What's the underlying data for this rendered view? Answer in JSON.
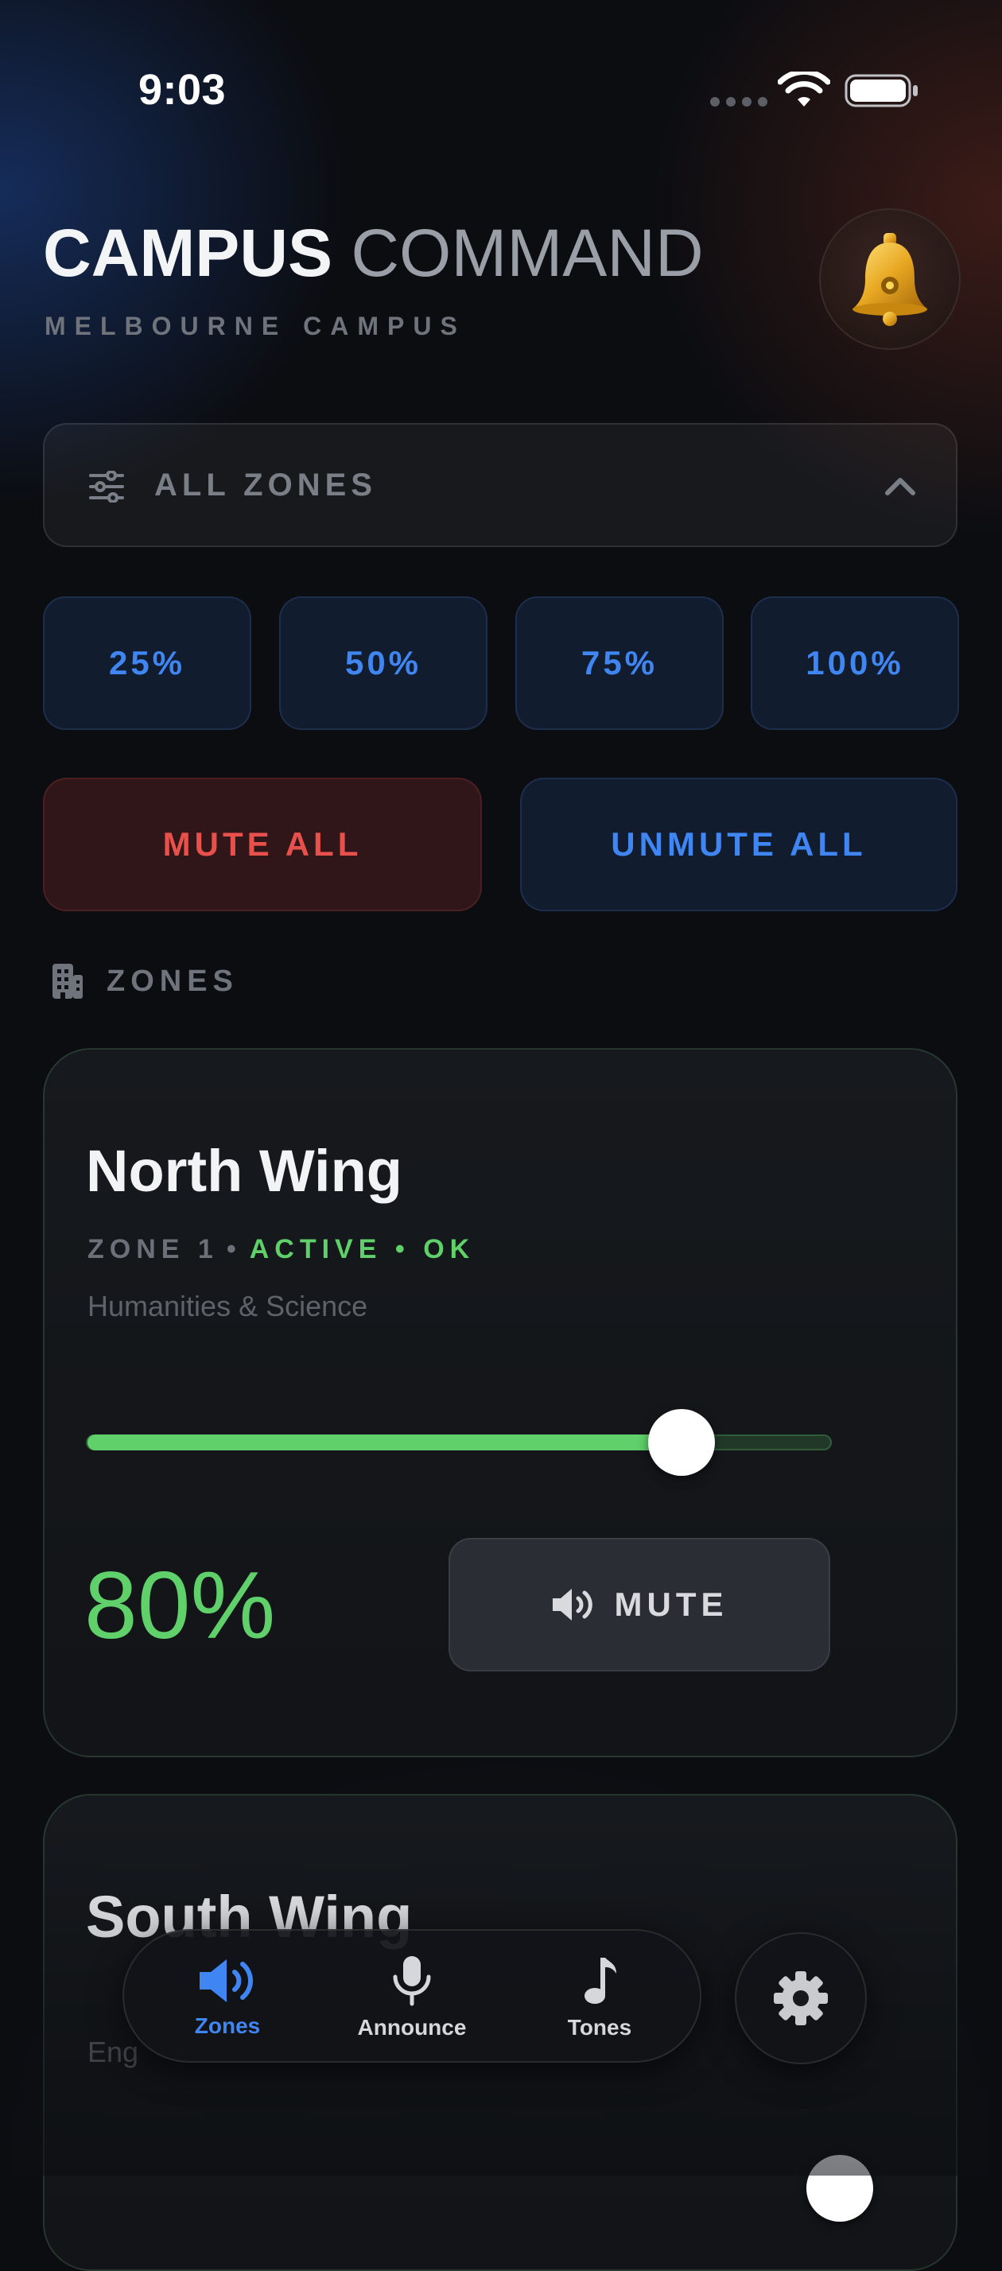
{
  "status_bar": {
    "time": "9:03"
  },
  "header": {
    "title_bold": "CAMPUS",
    "title_light": "COMMAND",
    "subtitle": "MELBOURNE CAMPUS"
  },
  "zone_selector": {
    "label": "ALL ZONES"
  },
  "presets": [
    "25%",
    "50%",
    "75%",
    "100%"
  ],
  "bulk_actions": {
    "mute_all": "MUTE ALL",
    "unmute_all": "UNMUTE ALL"
  },
  "zones_section": {
    "heading": "ZONES"
  },
  "zones": [
    {
      "name": "North Wing",
      "zone_id": "ZONE 1",
      "status": "ACTIVE • OK",
      "description": "Humanities & Science",
      "volume_percent": 80,
      "volume_label": "80%",
      "mute_label": "MUTE"
    },
    {
      "name": "South Wing",
      "zone_id": "",
      "status": "",
      "description": "Eng",
      "volume_percent": 90
    }
  ],
  "tabbar": {
    "tabs": [
      {
        "label": "Zones",
        "icon": "speaker-icon",
        "active": true
      },
      {
        "label": "Announce",
        "icon": "microphone-icon",
        "active": false
      },
      {
        "label": "Tones",
        "icon": "music-note-icon",
        "active": false
      }
    ]
  },
  "colors": {
    "accent_blue": "#3f86f2",
    "accent_green": "#5fd06a",
    "accent_red": "#e8504c"
  }
}
